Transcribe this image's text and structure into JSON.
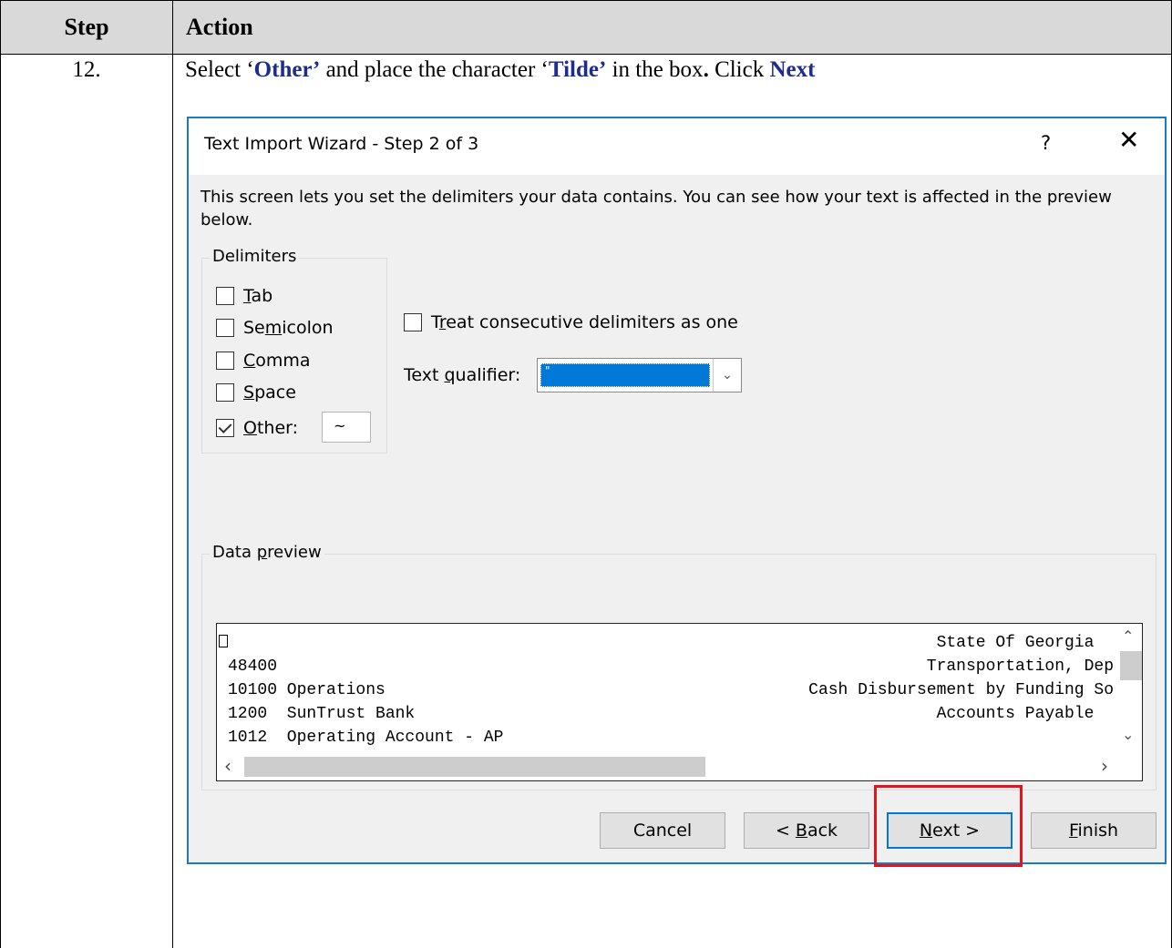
{
  "table": {
    "header_step": "Step",
    "header_action": "Action",
    "step_number": "12.",
    "instruction": {
      "part1": "Select ‘",
      "kw1": "Other’",
      "part2": " and place the character ‘",
      "kw2": "Tilde’",
      "part3": " in the box",
      "dot": ".",
      "part4": " Click ",
      "kw3": "Next"
    }
  },
  "dialog": {
    "title": "Text Import Wizard - Step 2 of 3",
    "help_glyph": "?",
    "close_glyph": "✕",
    "description": "This screen lets you set the delimiters your data contains.  You can see how your text is affected in the preview below.",
    "delimiters": {
      "legend": "Delimiters",
      "options": [
        {
          "pre": "",
          "ul": "T",
          "post": "ab",
          "checked": false
        },
        {
          "pre": "Se",
          "ul": "m",
          "post": "icolon",
          "checked": false
        },
        {
          "pre": "",
          "ul": "C",
          "post": "omma",
          "checked": false
        },
        {
          "pre": "",
          "ul": "S",
          "post": "pace",
          "checked": false
        },
        {
          "pre": "",
          "ul": "O",
          "post": "ther:",
          "checked": true
        }
      ],
      "other_value": "~"
    },
    "treat_consecutive": {
      "pre": "T",
      "ul": "r",
      "post": "eat consecutive delimiters as one",
      "checked": false
    },
    "text_qualifier": {
      "pre": "Text ",
      "ul": "q",
      "post": "ualifier:",
      "value": "\""
    },
    "data_preview": {
      "legend_pre": "Data ",
      "legend_ul": "p",
      "legend_post": "review",
      "lines": [
        {
          "left": "",
          "right": "State Of Georgia  "
        },
        {
          "left": "48400",
          "right": "Transportation, Dep"
        },
        {
          "left": "10100 Operations",
          "right": "Cash Disbursement by Funding So"
        },
        {
          "left": "1200  SunTrust Bank",
          "right": "Accounts Payable  "
        },
        {
          "left": "1012  Operating Account - AP",
          "right": ""
        }
      ]
    },
    "buttons": {
      "cancel": "Cancel",
      "back_pre": "< ",
      "back_ul": "B",
      "back_post": "ack",
      "next_ul": "N",
      "next_post": "ext >",
      "finish_ul": "F",
      "finish_post": "inish"
    }
  },
  "colors": {
    "keyword": "#1f2c8f",
    "highlight_box": "#e3141b",
    "dialog_border": "#1979ca",
    "selection": "#0078d7"
  }
}
